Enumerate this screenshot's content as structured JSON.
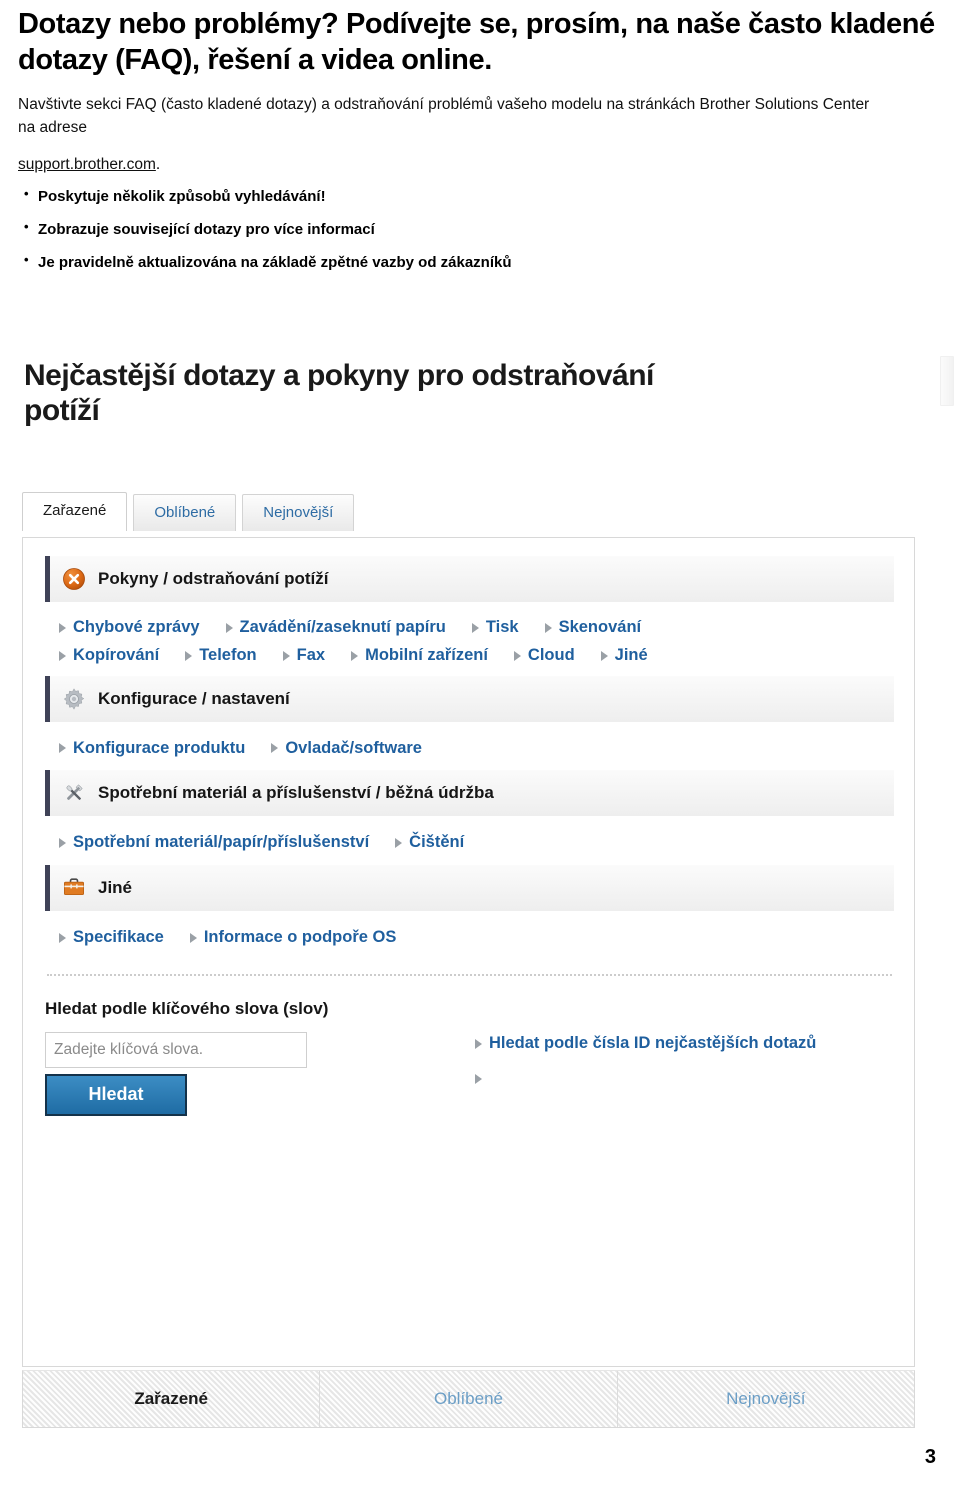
{
  "document": {
    "heading": "Dotazy nebo problémy? Podívejte se, prosím, na naše často kladené dotazy (FAQ), řešení a videa online.",
    "paragraph": "Navštivte sekci FAQ (často kladené dotazy) a odstraňování problémů vašeho modelu na stránkách Brother Solutions Center na adrese",
    "link_text": "support.brother.com",
    "link_suffix": ".",
    "bullets": [
      "Poskytuje několik způsobů vyhledávání!",
      "Zobrazuje související dotazy pro více informací",
      "Je pravidelně aktualizována na základě zpětné vazby od zákazníků"
    ],
    "page_number": "3"
  },
  "screenshot": {
    "title": "Nejčastější dotazy a pokyny pro odstraňování potíží",
    "tabs": [
      {
        "label": "Zařazené",
        "active": true
      },
      {
        "label": "Oblíbené",
        "active": false
      },
      {
        "label": "Nejnovější",
        "active": false
      }
    ],
    "categories": [
      {
        "icon": "error-circle-icon",
        "title": "Pokyny / odstraňování potíží",
        "links_row1": [
          "Chybové zprávy",
          "Zavádění/zaseknutí papíru",
          "Tisk",
          "Skenování"
        ],
        "links_row2": [
          "Kopírování",
          "Telefon",
          "Fax",
          "Mobilní zařízení",
          "Cloud",
          "Jiné"
        ]
      },
      {
        "icon": "gear-icon",
        "title": "Konfigurace / nastavení",
        "links_row1": [
          "Konfigurace produktu",
          "Ovladač/software"
        ],
        "links_row2": []
      },
      {
        "icon": "tools-icon",
        "title": "Spotřební materiál a příslušenství / běžná údržba",
        "links_row1": [
          "Spotřební materiál/papír/příslušenství",
          "Čištění"
        ],
        "links_row2": []
      },
      {
        "icon": "briefcase-icon",
        "title": "Jiné",
        "links_row1": [
          "Specifikace",
          "Informace o podpoře OS"
        ],
        "links_row2": []
      }
    ],
    "search": {
      "label": "Hledat podle klíčového slova (slov)",
      "input_placeholder": "Zadejte klíčová slova.",
      "input_value": "",
      "button_label": "Hledat",
      "side_links": [
        "Hledat podle čísla ID nejčastějších dotazů",
        ""
      ]
    },
    "footer_tabs": [
      {
        "label": "Zařazené",
        "active": true
      },
      {
        "label": "Oblíbené",
        "active": false
      },
      {
        "label": "Nejnovější",
        "active": false
      }
    ],
    "colors": {
      "link_blue": "#1f5f9e",
      "tab_blue": "#2e6ca4",
      "accent_orange": "#d9651a",
      "button_blue": "#1f6ca4",
      "header_bar_accent": "#3f4257"
    }
  }
}
